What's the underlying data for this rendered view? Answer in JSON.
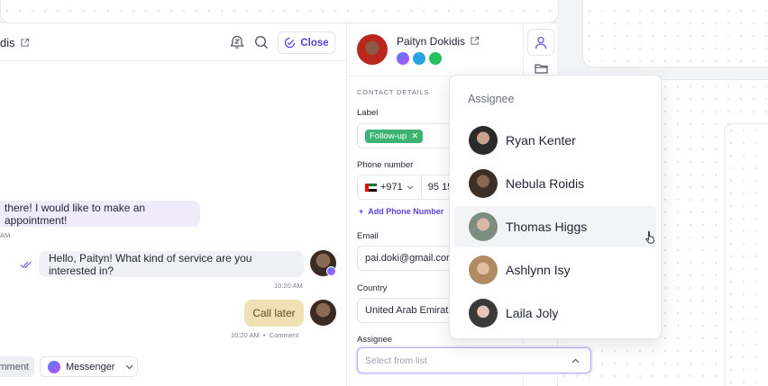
{
  "chat": {
    "contact_name": "dis",
    "close_label": "Close",
    "messages": [
      {
        "text": "there! I would like to make an appointment!",
        "time": "AM"
      },
      {
        "text": "Hello, Paityn! What kind of service are you interested in?",
        "time": "10:20 AM"
      },
      {
        "text": "Call later",
        "time": "10:20 AM",
        "tag": "Comment"
      }
    ],
    "footer": {
      "comment_label": "mment",
      "channel_label": "Messenger"
    }
  },
  "contact": {
    "name": "Paityn Dokidis",
    "section_title": "CONTACT DETAILS",
    "label_field": {
      "label": "Label",
      "tag": "Follow-up"
    },
    "phone_field": {
      "label": "Phone number",
      "code": "+971",
      "number": "95 15",
      "add_label": "Add Phone Number"
    },
    "email_field": {
      "label": "Email",
      "value": "pai.doki@gmail.com"
    },
    "country_field": {
      "label": "Country",
      "value": "United Arab Emirates"
    },
    "assignee_field": {
      "label": "Assignee",
      "placeholder": "Select from list"
    }
  },
  "dropdown": {
    "title": "Assignee",
    "items": [
      {
        "name": "Ryan Kenter",
        "color": "#2b2b2b"
      },
      {
        "name": "Nebula Roidis",
        "color": "#5a4a3e"
      },
      {
        "name": "Thomas Higgs",
        "color": "#7b8e80"
      },
      {
        "name": "Ashlynn Isy",
        "color": "#c9a37a"
      },
      {
        "name": "Laila Joly",
        "color": "#7a5b4a"
      }
    ],
    "hovered_index": 2
  },
  "colors": {
    "accent": "#5b3fd6",
    "tag_green": "#3cb371",
    "bubble_in": "#efebfd",
    "bubble_out": "#f0f1f4",
    "bubble_comment": "#efe1b3"
  }
}
